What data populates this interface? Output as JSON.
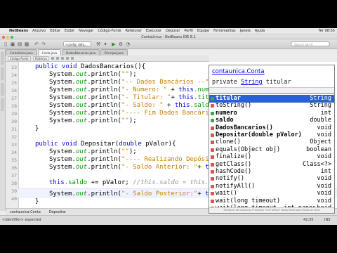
{
  "menubar": {
    "items": [
      "NetBeans",
      "Arquivo",
      "Editar",
      "Exibir",
      "Navegar",
      "Código-Fonte",
      "Refatorar",
      "Executar",
      "Depurar",
      "Perfil",
      "Equipe",
      "Ferramentas",
      "Janela",
      "Ajuda"
    ],
    "right": [
      "Ter 08:55"
    ]
  },
  "window": {
    "title": "ContaUnica - NetBeans IDE 8.1"
  },
  "toolbar": {
    "config": "<config. defa...",
    "search_placeholder": "Search (⌘+I)"
  },
  "editor_tabs": [
    "ContaUnica.java",
    "Conta.java",
    "DadosBancarios.java",
    "Principal.java"
  ],
  "editor_toolbar": {
    "source": "Código-Fonte",
    "history": "Histórico"
  },
  "lines": [
    {
      "n": "23"
    },
    {
      "n": "24"
    },
    {
      "n": "25"
    },
    {
      "n": "26"
    },
    {
      "n": "27"
    },
    {
      "n": "28"
    },
    {
      "n": "29"
    },
    {
      "n": "30"
    },
    {
      "n": "31"
    },
    {
      "n": "32"
    },
    {
      "n": "33"
    },
    {
      "n": "34"
    },
    {
      "n": "35"
    },
    {
      "n": "36"
    },
    {
      "n": "37"
    },
    {
      "n": "38"
    },
    {
      "n": "39"
    },
    {
      "n": "40"
    },
    {
      "n": "41"
    },
    {
      "n": "42"
    }
  ],
  "code": {
    "l1_kw": "public void ",
    "l1_rest": "DadosBancarios(){",
    "sys": "System.",
    "out": "out",
    "println": ".println(",
    "l2_str": "\"\"",
    "l2_end": ");",
    "l3_str": "\"-- Dados Bancários --\"",
    "l3_end": ");",
    "l4_str": "\"- Número: \"",
    "l4_mid": " + ",
    "l4_this": "this",
    "l4_fld": ".numero",
    "l5_str": "\"- Titular: \"",
    "l5_mid": "+ ",
    "l5_this": "this",
    "l5_fld": ".titul",
    "l6_str": "\"- Saldo: \"",
    "l6_mid": " + ",
    "l6_this": "this",
    "l6_fld": ".saldo",
    "l7_str": "\"---- Fim Dados Bancários",
    "l8_str": "\"\"",
    "l8_end": ");",
    "close": "}",
    "l10_kw": "public void ",
    "l10_name": "Depositar",
    "l10_p1": "(",
    "l10_kw2": "double",
    "l10_p2": " pValor){",
    "l11_str": "\"\"",
    "l11_end": ");",
    "l12_str": "\"---- Realizando Depósito",
    "l13_str": "\"- Saldo Anterior: \"",
    "l13_mid": "+ ",
    "l13_this": "this",
    "l14_this": "this",
    "l14_fld": ".saldo",
    "l14_mid": " += pValor; ",
    "l14_cm": "//this.saldo = this.sa",
    "l15_str": "\"- Saldo Posterior:\"",
    "l15_mid": "+ ",
    "l15_this": "this",
    "l15_dot": ".",
    "l15_end": ");"
  },
  "javadoc": {
    "package": "contaunica.Conta",
    "sig_kw": "private ",
    "sig_type": "String",
    "sig_name": " titular"
  },
  "completion": [
    {
      "name": "titular",
      "type": "String",
      "kind": "field",
      "bold": true
    },
    {
      "name": "toString()",
      "type": "String",
      "kind": "method",
      "bold": false
    },
    {
      "name": "numero",
      "type": "int",
      "kind": "field",
      "bold": true
    },
    {
      "name": "saldo",
      "type": "double",
      "kind": "field",
      "bold": true
    },
    {
      "name": "DadosBancarios()",
      "type": "void",
      "kind": "method",
      "bold": true
    },
    {
      "name": "Depositar(double pValor)",
      "type": "void",
      "kind": "method",
      "bold": true
    },
    {
      "name": "clone()",
      "type": "Object",
      "kind": "method",
      "bold": false
    },
    {
      "name": "equals(Object obj)",
      "type": "boolean",
      "kind": "method",
      "bold": false
    },
    {
      "name": "finalize()",
      "type": "void",
      "kind": "method",
      "bold": false
    },
    {
      "name": "getClass()",
      "type": "Class<?>",
      "kind": "method",
      "bold": false
    },
    {
      "name": "hashCode()",
      "type": "int",
      "kind": "method",
      "bold": false
    },
    {
      "name": "notify()",
      "type": "void",
      "kind": "method",
      "bold": false
    },
    {
      "name": "notifyAll()",
      "type": "void",
      "kind": "method",
      "bold": false
    },
    {
      "name": "wait()",
      "type": "void",
      "kind": "method",
      "bold": false
    },
    {
      "name": "wait(long timeout)",
      "type": "void",
      "kind": "method",
      "bold": false
    },
    {
      "name": "wait(long timeout, int nanos)",
      "type": "void",
      "kind": "method",
      "bold": false
    }
  ],
  "completion_footer": "Membros de instancia; Pressione 'Ctrl+SPACE' Novamente para Todos os Itens",
  "breadcrumbs": [
    "contaunica.Conta",
    "Depositar"
  ],
  "status": {
    "left": "<identifier> expected",
    "pos": "42:35",
    "mode": "INS"
  },
  "colors": {
    "keyword": "#0000e6",
    "field": "#009900",
    "string": "#ce7b00",
    "selection": "#2a60d6"
  }
}
